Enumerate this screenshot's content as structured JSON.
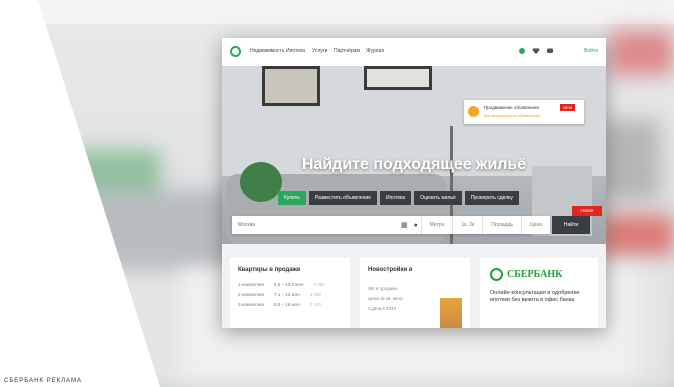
{
  "colors": {
    "accent": "#29a85c",
    "dark": "#3b3e41",
    "alert": "#e0271f",
    "sber": "#21a038"
  },
  "nav": {
    "links": [
      "Недвижимость",
      "Ипотека",
      "Услуги",
      "Партнёрам",
      "Журнал"
    ],
    "icons": [
      "bell-icon",
      "heart-icon",
      "chat-icon"
    ],
    "login": "Войти"
  },
  "notification": {
    "title": "Продвижение объявления",
    "badge": "NEW",
    "subtitle": "Все возможности объявлений"
  },
  "hero": {
    "title": "Найдите подходящее жильё",
    "tabs": [
      "Купить",
      "Разместить объявление",
      "Ипотека",
      "Оценить жильё",
      "Проверить сделку"
    ],
    "active_tab": 0
  },
  "search": {
    "placeholder": "Москва",
    "segments": [
      "Метро",
      "Площадь",
      "Цена"
    ],
    "rooms": "1к, 2к",
    "button": "Найти",
    "badge": "Новое"
  },
  "cards": {
    "flats": {
      "title": "Квартиры в продаже",
      "rows": [
        [
          "1-комнатная",
          "6,5 – 10,0 млн",
          "4 000"
        ],
        [
          "2-комнатная",
          "7,1 – 13 млн",
          "3 200"
        ],
        [
          "3-комнатная",
          "8,5 – 16 млн",
          "2 100"
        ]
      ]
    },
    "newbuild": {
      "title": "Новостройки в",
      "lines": [
        "ЖК в продаже",
        "Цена за кв. метр",
        "Сдача в 2023"
      ]
    },
    "sber": {
      "name": "СБЕРБАНК",
      "text": "Онлайн-консультация и одобрение ипотеки без визита в офис банка"
    }
  },
  "caption": "СБЕРБАНК РЕКЛАМА"
}
